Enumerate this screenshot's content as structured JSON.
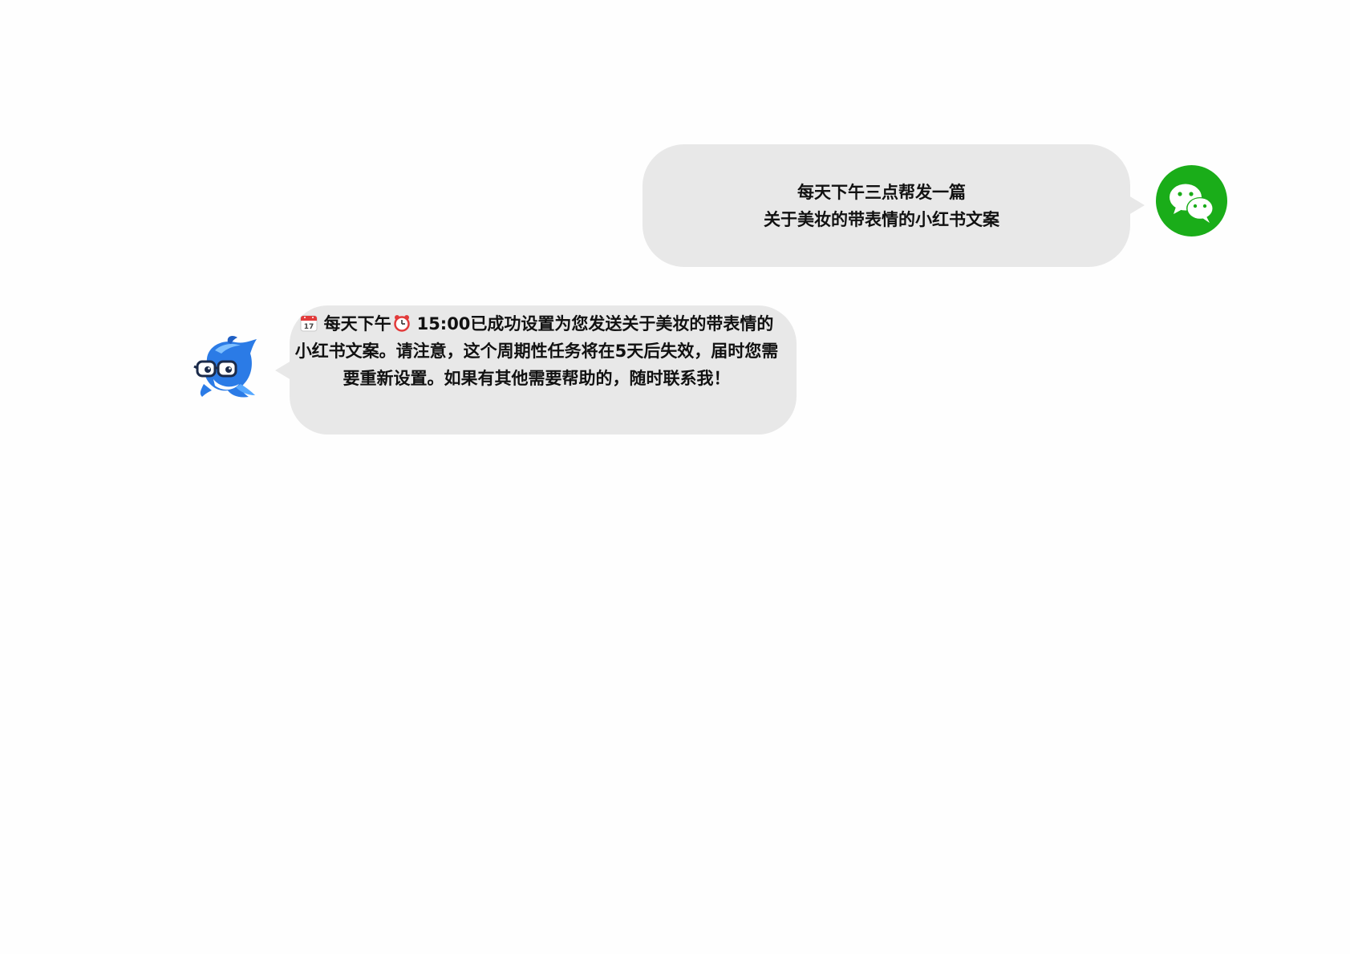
{
  "conversation": {
    "user_message": {
      "line1": "每天下午三点帮发一篇",
      "line2": "关于美妆的带表情的小红书文案",
      "avatar_icon": "wechat-icon",
      "avatar_color": "#1aad19"
    },
    "bot_message": {
      "calendar_icon": "calendar-emoji-icon",
      "calendar_day": "17",
      "segment1": "每天下午",
      "alarm_icon": "alarm-clock-emoji-icon",
      "segment2": "15:00已成功设置为您发送关于美妆的带表情的小红书文案。请注意，这个周期性任务将在5天后失效，届时您需要重新设置。如果有其他需要帮助的，随时联系我！",
      "avatar_icon": "dolphin-mascot-icon"
    },
    "bubble_color": "#e8e8e8"
  }
}
